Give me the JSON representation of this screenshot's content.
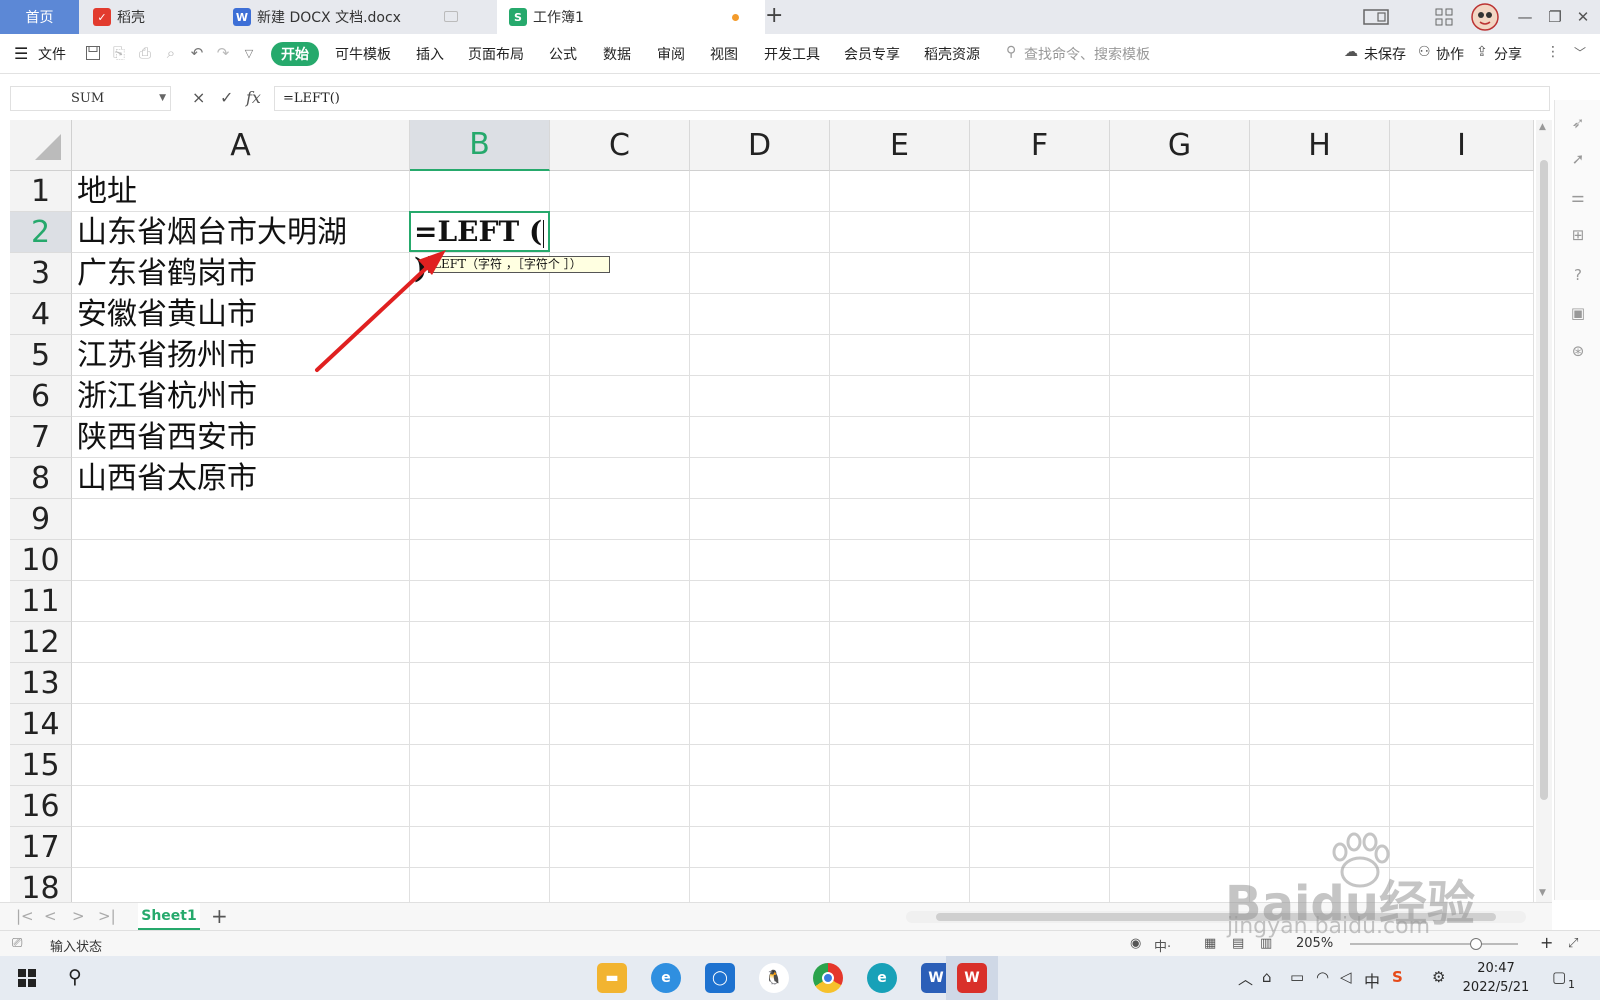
{
  "tabs": {
    "home": "首页",
    "daoke": "稻壳",
    "docx": "新建 DOCX 文档.docx",
    "workbook": "工作簿1",
    "new_tab": "+"
  },
  "menu": {
    "file": "文件",
    "start": "开始",
    "items": [
      "可牛模板",
      "插入",
      "页面布局",
      "公式",
      "数据",
      "审阅",
      "视图",
      "开发工具",
      "会员专享",
      "稻壳资源"
    ],
    "search_placeholder": "查找命令、搜索模板",
    "unsaved": "未保存",
    "collab": "协作",
    "share": "分享"
  },
  "formula_bar": {
    "name_box": "SUM",
    "cancel": "×",
    "confirm": "✓",
    "fx": "fx",
    "formula": "=LEFT()"
  },
  "sheet": {
    "columns": [
      "A",
      "B",
      "C",
      "D",
      "E",
      "F",
      "G",
      "H",
      "I"
    ],
    "selected_column": "B",
    "rows": [
      "1",
      "2",
      "3",
      "4",
      "5",
      "6",
      "7",
      "8",
      "9",
      "10",
      "11",
      "12",
      "13",
      "14",
      "15",
      "16",
      "17",
      "18"
    ],
    "selected_row": "2",
    "column_a": [
      "地址",
      "山东省烟台市大明湖",
      "广东省鹤岗市",
      "安徽省黄山市",
      "江苏省扬州市",
      "浙江省杭州市",
      "陕西省西安市",
      "山西省太原市"
    ],
    "active_cell_before": "=LEFT (",
    "active_cell_after": ")",
    "tooltip": "LEFT（字符 ，［字符个 ］）"
  },
  "sheet_tabs": {
    "active": "Sheet1",
    "add": "+"
  },
  "status": {
    "mode": "输入状态",
    "zoom": "205%"
  },
  "taskbar": {
    "time": "20:47",
    "date": "2022/5/21",
    "ime": "中",
    "notifications": "1"
  },
  "watermark": {
    "brand": "Baidu经验",
    "url": "jingyan.baidu.com"
  },
  "colors": {
    "accent_green": "#26a96c",
    "home_tab_blue": "#5c88d6",
    "annotation_arrow": "#e02020"
  }
}
